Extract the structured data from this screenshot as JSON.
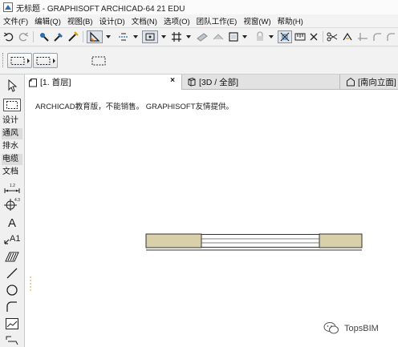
{
  "window": {
    "title": "无标题 - GRAPHISOFT ARCHICAD-64 21 EDU"
  },
  "menu": [
    "文件(F)",
    "编辑(Q)",
    "视图(B)",
    "设计(D)",
    "文档(N)",
    "选项(O)",
    "团队工作(E)",
    "视窗(W)",
    "帮助(H)"
  ],
  "toolbox": {
    "groups": {
      "design": "设计",
      "ventilation": "通风",
      "drainage": "排水",
      "cable": "电缆",
      "document": "文档"
    },
    "dimension_tag": "1.2",
    "level_tag": "4.3",
    "text_tool": "A",
    "label_tool": "A1"
  },
  "tabs": [
    {
      "label": "[1. 首层]",
      "close": "×"
    },
    {
      "label": "[3D / 全部]"
    },
    {
      "label": "[南向立面]"
    }
  ],
  "canvas": {
    "notice": "ARCHICAD教育版，不能销售。 GRAPHISOFT友情提供。"
  },
  "watermark": {
    "label": "TopsBIM"
  },
  "colors": {
    "wall_fill": "#d9cfa9",
    "wall_stroke": "#333333",
    "active_tool": "#dfe3ea"
  }
}
